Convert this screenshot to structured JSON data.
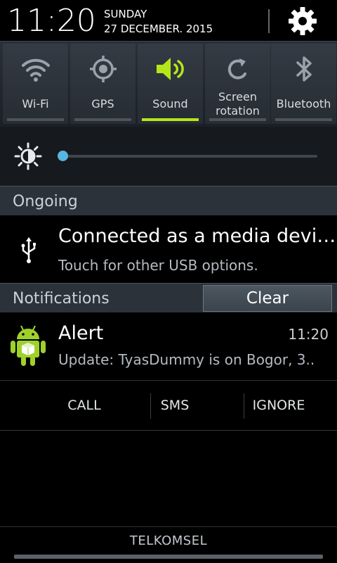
{
  "header": {
    "time": "11:20",
    "day": "SUNDAY",
    "date": "27 DECEMBER. 2015"
  },
  "quick_settings": [
    {
      "label": "Wi-Fi",
      "icon": "wifi-icon",
      "active": false
    },
    {
      "label": "GPS",
      "icon": "gps-icon",
      "active": false
    },
    {
      "label": "Sound",
      "icon": "sound-icon",
      "active": true
    },
    {
      "label": "Screen\nrotation",
      "icon": "rotation-icon",
      "active": false
    },
    {
      "label": "Bluetooth",
      "icon": "bluetooth-icon",
      "active": false
    }
  ],
  "brightness": {
    "icon": "brightness-icon",
    "level": 0
  },
  "ongoing": {
    "header": "Ongoing",
    "title": "Connected as a media devi…",
    "subtitle": "Touch for other USB options.",
    "icon": "usb-icon"
  },
  "notifications": {
    "header": "Notifications",
    "clear_label": "Clear",
    "items": [
      {
        "title": "Alert",
        "time": "11:20",
        "text": "Update: TyasDummy is on Bogor, 3..",
        "icon": "android-icon",
        "actions": [
          "CALL",
          "SMS",
          "IGNORE"
        ]
      }
    ]
  },
  "footer": {
    "carrier": "TELKOMSEL"
  },
  "colors": {
    "active": "#b4e61a",
    "slider": "#58b6e0",
    "header_bg": "#2c3239"
  }
}
